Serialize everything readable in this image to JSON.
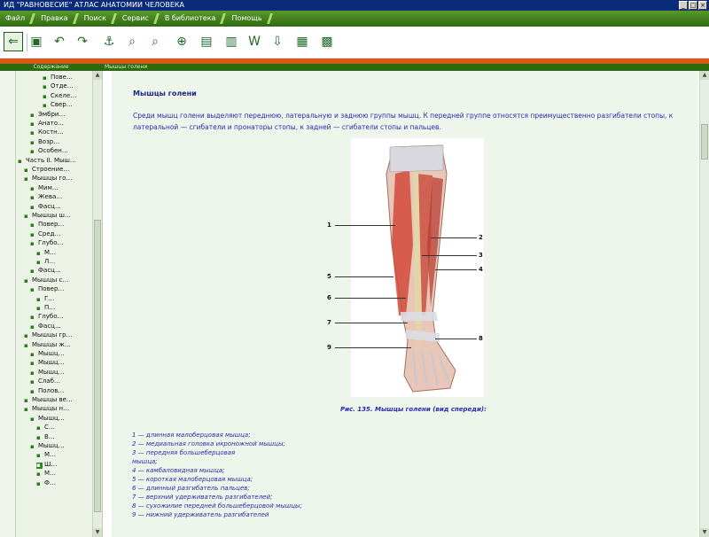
{
  "window": {
    "title": "ИД \"РАВНОВЕСИЕ\" АТЛАС АНАТОМИИ ЧЕЛОВЕКА",
    "btn_min": "_",
    "btn_max": "□",
    "btn_close": "×"
  },
  "menu": [
    "Файл",
    "Правка",
    "Поиск",
    "Сервис",
    "В библиотека",
    "Помощь"
  ],
  "toolbar": {
    "icons": [
      "back-arrow-icon",
      "open-book-icon",
      "undo-icon",
      "redo-icon",
      "anchor-icon",
      "search-icon",
      "search-advanced-icon",
      "find-icon",
      "print-icon",
      "bookmark-icon",
      "word-icon",
      "export-icon",
      "library-icon",
      "calendar-icon"
    ]
  },
  "left_panel": {
    "header": "Содержание",
    "tree": [
      "Пове…",
      "Отде…",
      "Скеле…",
      "Свер…",
      "Эмбри…",
      "Анато…",
      "Костн…",
      "Возр…",
      "Особен…",
      "Часть II. Мыш…",
      "Строение…",
      "Мышцы го…",
      "Мим…",
      "Жева…",
      "Фасц…",
      "Мышцы ш…",
      "Повер…",
      "Сред…",
      "Глубо…",
      "М…",
      "Л…",
      "Фасц…",
      "Мышцы с…",
      "Повер…",
      "Г…",
      "П…",
      "Глубо…",
      "Фасц…",
      "Мышцы гр…",
      "Мышцы ж…",
      "Мышц…",
      "Мышц…",
      "Мышц…",
      "Слаб…",
      "Полов…",
      "Мышцы ве…",
      "Мышцы н…",
      "Мышц…",
      "С…",
      "В…",
      "Мышц…",
      "М…",
      "Ш…",
      "М…",
      "Ф…"
    ]
  },
  "content": {
    "header": "Мышцы голени",
    "title": "Мышцы голени",
    "intro": "Среди мышц голени выделяют переднюю, латеральную и заднюю группы мышц. К передней группе относятся преимущественно разгибатели стопы, к латеральной — сгибатели и пронаторы стопы, к задней — сгибатели стопы и пальцев.",
    "labels": [
      "1",
      "2",
      "3",
      "4",
      "5",
      "6",
      "7",
      "8",
      "9"
    ],
    "caption": "Рис. 135. Мышцы голени (вид спереди):",
    "legend": [
      "1 — длинная малоберцовая мышца;",
      "2 — медиальная головка икроножной мышцы;",
      "3 — передняя большеберцовая",
      "мышца;",
      "4 — камбаловидная мышца;",
      "5 — короткая малоберцовая мышца;",
      "6 — длинный разгибатель пальцев;",
      "7 — верхний удерживатель разгибателей;",
      "8 — сухожилие передней большеберцовой мышцы;",
      "9 — нижний удерживатель разгибателей"
    ]
  },
  "colors": {
    "menubar": "#2e6a12",
    "accent": "#d65a16",
    "text_blue": "#2a2ab0"
  }
}
